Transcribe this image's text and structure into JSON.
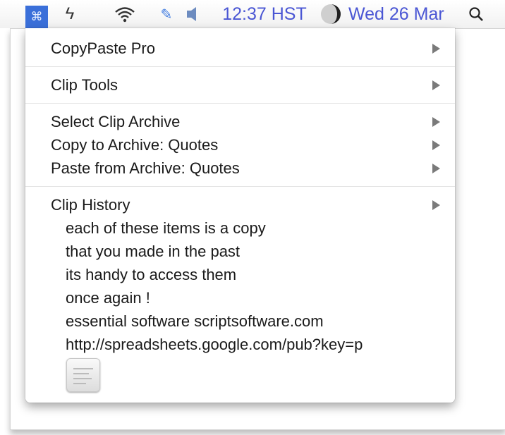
{
  "menubar": {
    "clock": "12:37 HST",
    "date": "Wed 26 Mar",
    "icons": [
      "copypaste-menu-icon",
      "bolt-icon",
      "wifi-icon",
      "pin-icon",
      "volume-icon",
      "moon-icon",
      "spotlight-search-icon"
    ],
    "accent_color": "#3a6fd9",
    "text_color": "#4a56d4"
  },
  "menu": {
    "items": [
      {
        "label": "CopyPaste Pro",
        "submenu": true
      },
      {
        "label": "Clip Tools",
        "submenu": true
      },
      {
        "label": "Select Clip Archive",
        "submenu": true
      },
      {
        "label": "Copy to Archive: Quotes",
        "submenu": true
      },
      {
        "label": "Paste from Archive: Quotes",
        "submenu": true
      },
      {
        "label": "Clip History",
        "submenu": true
      }
    ],
    "history": [
      "each of these items is a copy",
      "that you made in the past",
      "its handy to access them",
      "once again !",
      "essential software scriptsoftware.com",
      "http://spreadsheets.google.com/pub?key=p"
    ],
    "history_image_icon": "document-thumbnail-icon"
  }
}
